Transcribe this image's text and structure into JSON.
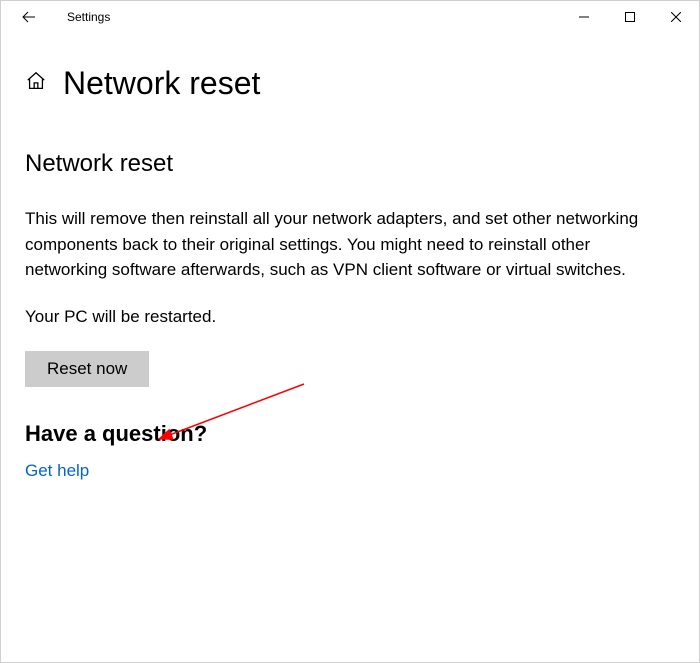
{
  "window": {
    "title": "Settings"
  },
  "page": {
    "title": "Network reset"
  },
  "section": {
    "heading": "Network reset",
    "description": "This will remove then reinstall all your network adapters, and set other networking components back to their original settings. You might need to reinstall other networking software afterwards, such as VPN client software or virtual switches.",
    "restart_note": "Your PC will be restarted.",
    "reset_button": "Reset now"
  },
  "help": {
    "heading": "Have a question?",
    "link": "Get help"
  }
}
